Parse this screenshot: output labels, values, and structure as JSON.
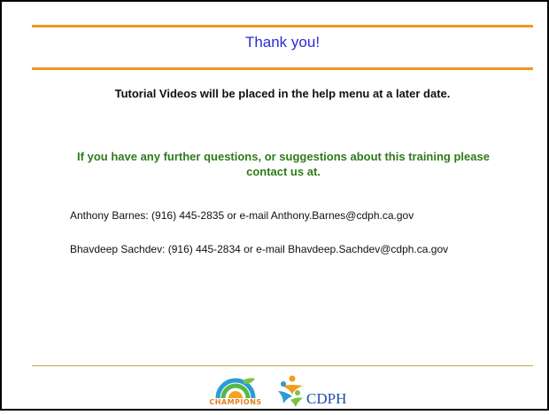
{
  "slide": {
    "title": "Thank you!",
    "notice": "Tutorial Videos will be placed in the help menu at a later date.",
    "questions": "If you have any further questions, or suggestions about this training please contact us at.",
    "contacts": [
      {
        "text": "Anthony Barnes:  (916) 445-2835 or e-mail Anthony.Barnes@cdph.ca.gov"
      },
      {
        "text": "Bhavdeep Sachdev:  (916) 445-2834 or e-mail Bhavdeep.Sachdev@cdph.ca.gov"
      }
    ],
    "logos": {
      "champions": "CHAMPIONS",
      "cdph": "CDPH"
    }
  },
  "colors": {
    "rule": "#f0961e",
    "title": "#2b2bd6",
    "questions": "#2f7a1a",
    "footer_rule": "#c7a640"
  }
}
